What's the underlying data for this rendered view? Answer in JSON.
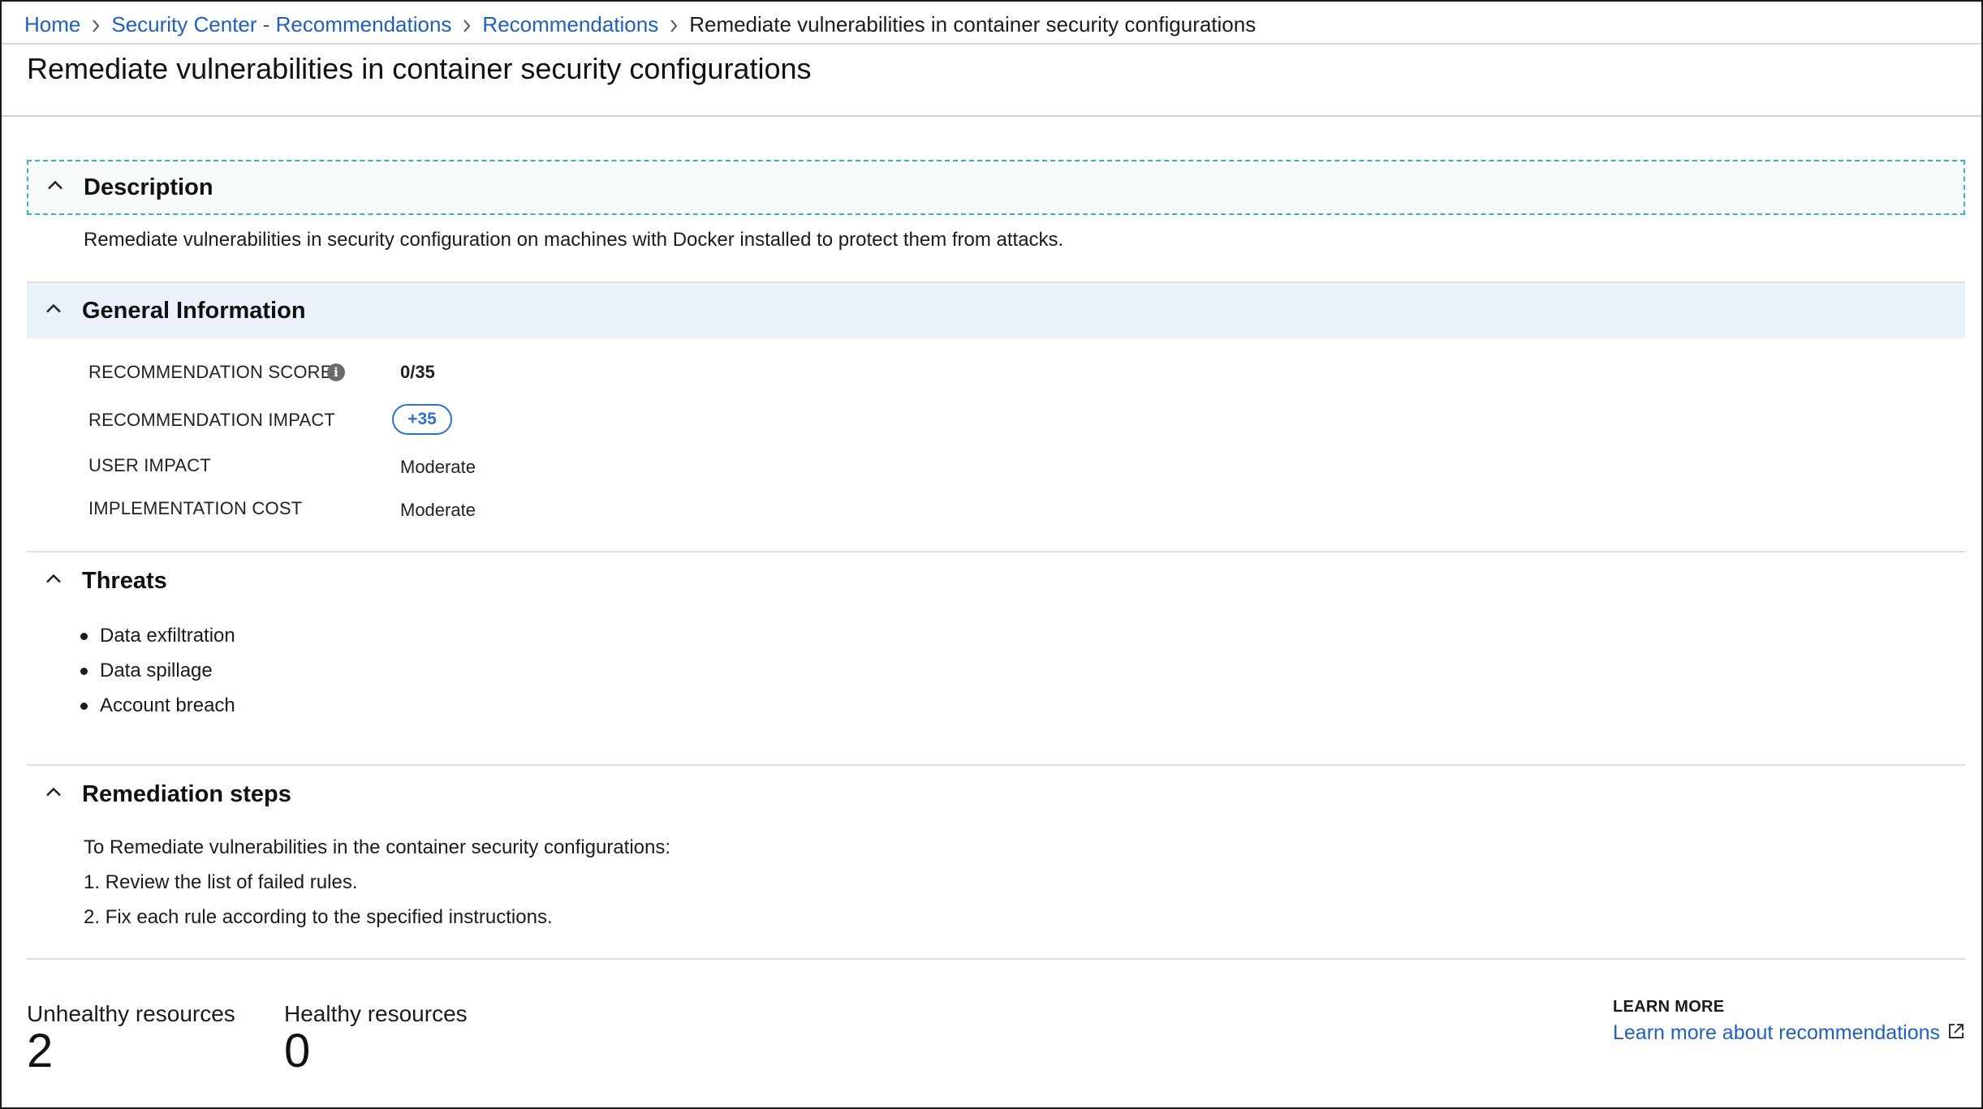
{
  "breadcrumb": {
    "items": [
      "Home",
      "Security Center - Recommendations",
      "Recommendations"
    ],
    "current": "Remediate vulnerabilities in container security configurations"
  },
  "page": {
    "title": "Remediate vulnerabilities in container security configurations"
  },
  "description": {
    "title": "Description",
    "text": "Remediate vulnerabilities in security configuration on machines with Docker installed to protect them from attacks."
  },
  "general": {
    "title": "General Information",
    "score_label": "RECOMMENDATION SCORE",
    "score_value": "0/35",
    "impact_label": "RECOMMENDATION IMPACT",
    "impact_value": "+35",
    "user_impact_label": "USER IMPACT",
    "user_impact_value": "Moderate",
    "cost_label": "IMPLEMENTATION COST",
    "cost_value": "Moderate"
  },
  "threats": {
    "title": "Threats",
    "items": [
      "Data exfiltration",
      "Data spillage",
      "Account breach"
    ]
  },
  "remediation": {
    "title": "Remediation steps",
    "intro": "To Remediate vulnerabilities in the container security configurations:",
    "steps": [
      "1. Review the list of failed rules.",
      "2. Fix each rule according to the specified instructions."
    ]
  },
  "resources": {
    "unhealthy_label": "Unhealthy resources",
    "unhealthy_value": "2",
    "healthy_label": "Healthy resources",
    "healthy_value": "0"
  },
  "learn_more": {
    "caption": "LEARN MORE",
    "link_text": "Learn more about recommendations"
  },
  "colors": {
    "link": "#1f5fbf",
    "pill": "#2f6fd0",
    "general_header_bg": "#eaf1f9",
    "focus_outline": "#3ab0c8"
  },
  "icons": [
    "chevron-right-icon",
    "chevron-up-icon",
    "info-icon",
    "external-link-icon"
  ]
}
